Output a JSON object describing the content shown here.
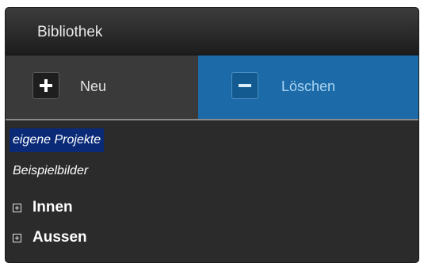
{
  "panel": {
    "title": "Bibliothek"
  },
  "toolbar": {
    "new_label": "Neu",
    "new_icon": "plus-icon",
    "delete_label": "Löschen",
    "delete_icon": "minus-icon",
    "delete_active_color": "#1c6ba8"
  },
  "tree": {
    "items": [
      {
        "label": "eigene Projekte",
        "selected": true
      },
      {
        "label": "Beispielbilder",
        "selected": false
      },
      {
        "label": "Innen",
        "expandable": true,
        "expanded": false
      },
      {
        "label": "Aussen",
        "expandable": true,
        "expanded": false
      }
    ],
    "selection_color": "#0a2a78"
  }
}
